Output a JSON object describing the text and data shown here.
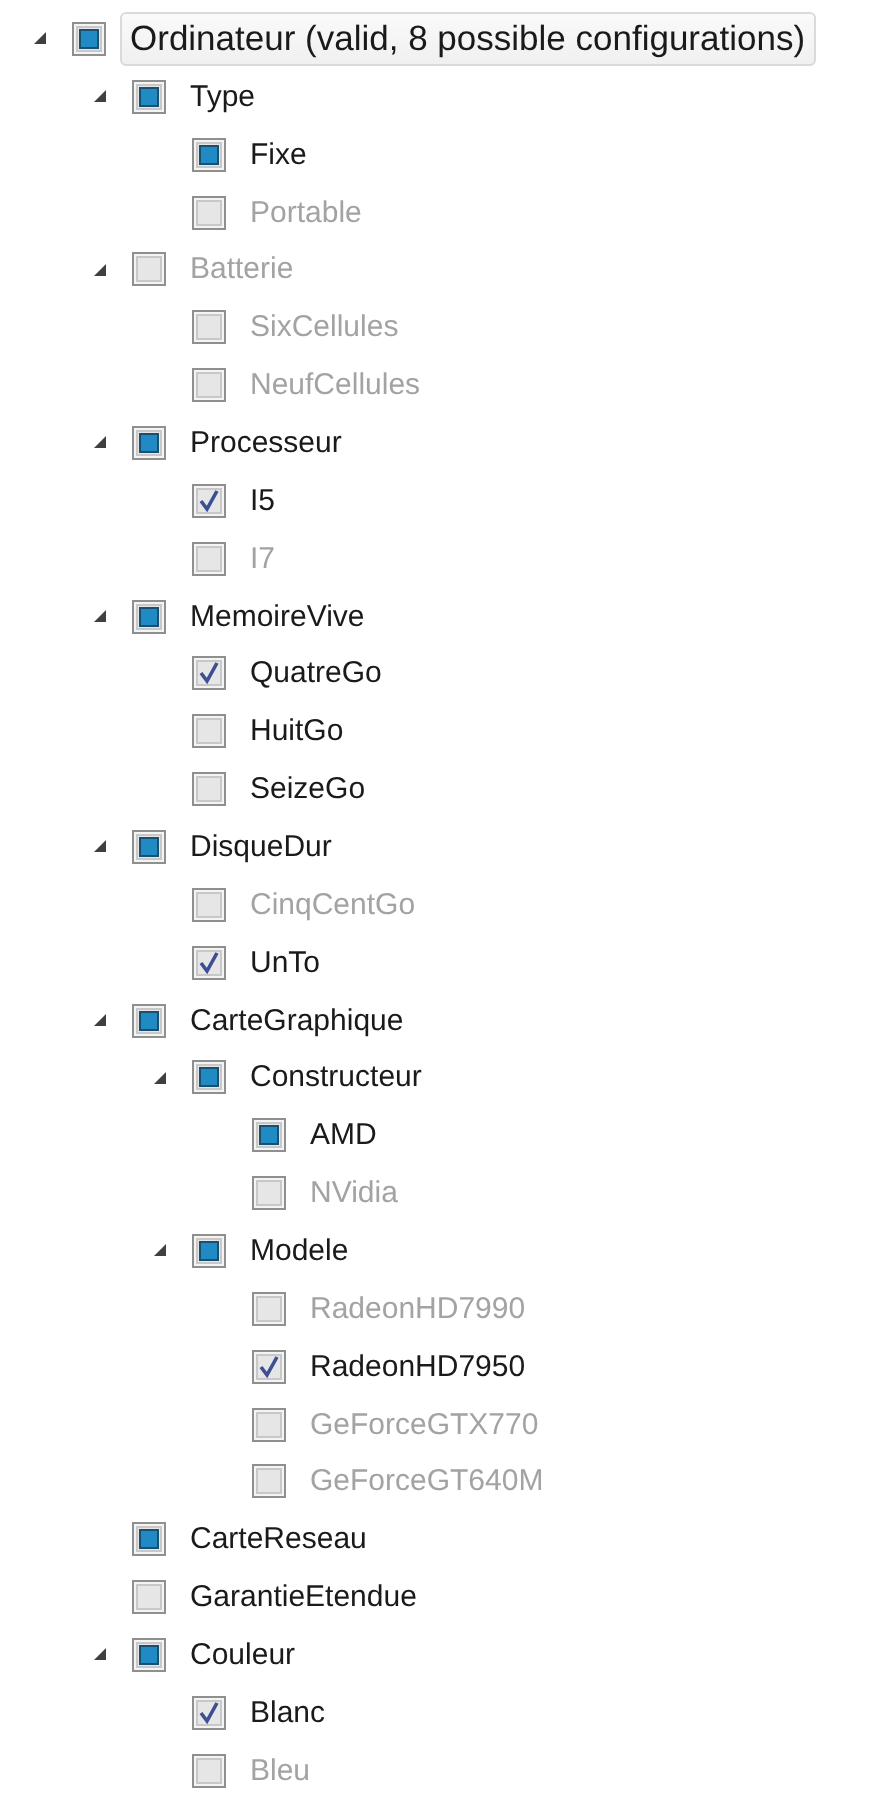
{
  "tree": [
    {
      "label": "Ordinateur (valid, 8 possible configurations)",
      "checked": false,
      "partial": true,
      "disabled": false,
      "selected": true,
      "expanded": true,
      "children": [
        {
          "label": "Type",
          "checked": false,
          "partial": true,
          "disabled": false,
          "selected": false,
          "expanded": true,
          "children": [
            {
              "label": "Fixe",
              "checked": false,
              "partial": true,
              "disabled": false,
              "selected": false
            },
            {
              "label": "Portable",
              "checked": false,
              "partial": false,
              "disabled": true,
              "selected": false
            }
          ]
        },
        {
          "label": "Batterie",
          "checked": false,
          "partial": false,
          "disabled": true,
          "selected": false,
          "expanded": true,
          "children": [
            {
              "label": "SixCellules",
              "checked": false,
              "partial": false,
              "disabled": true,
              "selected": false
            },
            {
              "label": "NeufCellules",
              "checked": false,
              "partial": false,
              "disabled": true,
              "selected": false
            }
          ]
        },
        {
          "label": "Processeur",
          "checked": false,
          "partial": true,
          "disabled": false,
          "selected": false,
          "expanded": true,
          "children": [
            {
              "label": "I5",
              "checked": true,
              "partial": false,
              "disabled": false,
              "selected": false
            },
            {
              "label": "I7",
              "checked": false,
              "partial": false,
              "disabled": true,
              "selected": false
            }
          ]
        },
        {
          "label": "MemoireVive",
          "checked": false,
          "partial": true,
          "disabled": false,
          "selected": false,
          "expanded": true,
          "children": [
            {
              "label": "QuatreGo",
              "checked": true,
              "partial": false,
              "disabled": false,
              "selected": false
            },
            {
              "label": "HuitGo",
              "checked": false,
              "partial": false,
              "disabled": false,
              "selected": false
            },
            {
              "label": "SeizeGo",
              "checked": false,
              "partial": false,
              "disabled": false,
              "selected": false
            }
          ]
        },
        {
          "label": "DisqueDur",
          "checked": false,
          "partial": true,
          "disabled": false,
          "selected": false,
          "expanded": true,
          "children": [
            {
              "label": "CinqCentGo",
              "checked": false,
              "partial": false,
              "disabled": true,
              "selected": false
            },
            {
              "label": "UnTo",
              "checked": true,
              "partial": false,
              "disabled": false,
              "selected": false
            }
          ]
        },
        {
          "label": "CarteGraphique",
          "checked": false,
          "partial": true,
          "disabled": false,
          "selected": false,
          "expanded": true,
          "children": [
            {
              "label": "Constructeur",
              "checked": false,
              "partial": true,
              "disabled": false,
              "selected": false,
              "expanded": true,
              "children": [
                {
                  "label": "AMD",
                  "checked": false,
                  "partial": true,
                  "disabled": false,
                  "selected": false
                },
                {
                  "label": "NVidia",
                  "checked": false,
                  "partial": false,
                  "disabled": true,
                  "selected": false
                }
              ]
            },
            {
              "label": "Modele",
              "checked": false,
              "partial": true,
              "disabled": false,
              "selected": false,
              "expanded": true,
              "children": [
                {
                  "label": "RadeonHD7990",
                  "checked": false,
                  "partial": false,
                  "disabled": true,
                  "selected": false
                },
                {
                  "label": "RadeonHD7950",
                  "checked": true,
                  "partial": false,
                  "disabled": false,
                  "selected": false
                },
                {
                  "label": "GeForceGTX770",
                  "checked": false,
                  "partial": false,
                  "disabled": true,
                  "selected": false
                },
                {
                  "label": "GeForceGT640M",
                  "checked": false,
                  "partial": false,
                  "disabled": true,
                  "selected": false
                }
              ]
            }
          ]
        },
        {
          "label": "CarteReseau",
          "checked": false,
          "partial": true,
          "disabled": false,
          "selected": false
        },
        {
          "label": "GarantieEtendue",
          "checked": false,
          "partial": false,
          "disabled": false,
          "selected": false
        },
        {
          "label": "Couleur",
          "checked": false,
          "partial": true,
          "disabled": false,
          "selected": false,
          "expanded": true,
          "children": [
            {
              "label": "Blanc",
              "checked": true,
              "partial": false,
              "disabled": false,
              "selected": false
            },
            {
              "label": "Bleu",
              "checked": false,
              "partial": false,
              "disabled": true,
              "selected": false
            }
          ]
        }
      ]
    }
  ]
}
